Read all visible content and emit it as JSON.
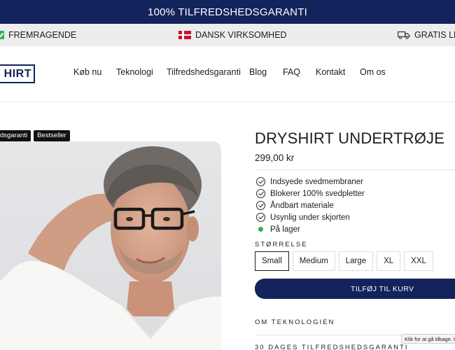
{
  "announcement": {
    "text": "100% TILFREDSHEDSGARANTI"
  },
  "trust_bar": {
    "items": [
      {
        "icon": "green-check-icon",
        "label": "FREMRAGENDE"
      },
      {
        "icon": "danish-flag-icon",
        "label": "DANSK VIRKSOMHED"
      },
      {
        "icon": "delivery-truck-icon",
        "label": "GRATIS LEV"
      }
    ]
  },
  "header": {
    "logo_text": "HIRT",
    "nav": [
      "Køb nu",
      "Teknologi",
      "Tilfredshedsgaranti",
      "Blog",
      "FAQ",
      "Kontakt",
      "Om os"
    ]
  },
  "badges": [
    "dsgaranti",
    "Bestseller"
  ],
  "product": {
    "title": "DRYSHIRT UNDERTRØJE",
    "price": "299,00 kr",
    "features": [
      "Indsyede svedmembraner",
      "Blokerer 100% svedpletter",
      "Åndbart materiale",
      "Usynlig under skjorten"
    ],
    "stock": "På lager",
    "size_label": "STØRRELSE",
    "sizes": [
      "Small",
      "Medium",
      "Large",
      "XL",
      "XXL"
    ],
    "selected_size": "Small",
    "add_to_cart": "TILFØJ TIL KURV"
  },
  "accordions": [
    "OM TEKNOLOGIEN",
    "30 DAGES TILFREDSHEDSGARANTI"
  ],
  "tooltip": "Klik for at gå tilbage. H",
  "colors": {
    "navy": "#13235b",
    "green": "#2fb457",
    "flag_red": "#c8102e"
  }
}
